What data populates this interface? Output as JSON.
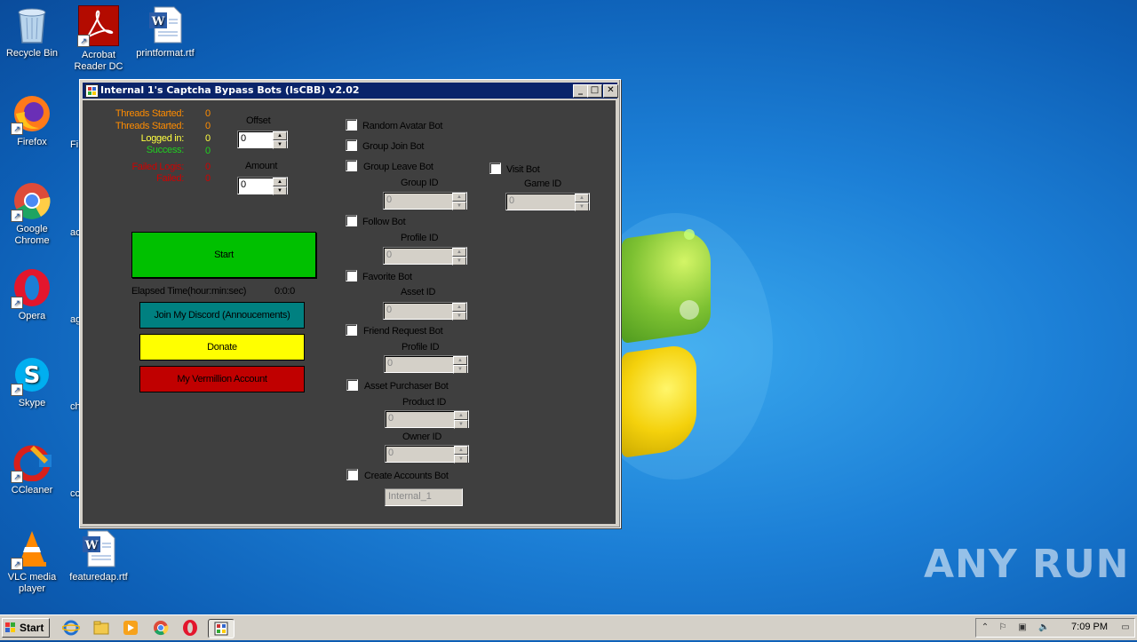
{
  "desktop": {
    "icons": [
      {
        "label": "Recycle Bin"
      },
      {
        "label": "Acrobat Reader DC"
      },
      {
        "label": "printformat.rtf"
      },
      {
        "label": "Firefox"
      },
      {
        "label": "Google Chrome"
      },
      {
        "label": "Opera"
      },
      {
        "label": "Skype"
      },
      {
        "label": "CCleaner"
      },
      {
        "label": "VLC media player"
      },
      {
        "label": "featuredap.rtf"
      }
    ],
    "clipped_labels": [
      "Fi",
      "ac",
      "ag",
      "ch",
      "cc"
    ],
    "watermark": "ANY RUN"
  },
  "window": {
    "title": "Internal 1's Captcha Bypass Bots (IsCBB) v2.02",
    "stats": [
      {
        "label": "Threads Started:",
        "value": "0",
        "color": "#ff8c00"
      },
      {
        "label": "Threads Started:",
        "value": "0",
        "color": "#ff8c00"
      },
      {
        "label": "Logged in:",
        "value": "0",
        "color": "#ffff40"
      },
      {
        "label": "Success:",
        "value": "0",
        "color": "#20d020"
      },
      {
        "label": "Failed Logis:",
        "value": "0",
        "color": "#d00000"
      },
      {
        "label": "Failed:",
        "value": "0",
        "color": "#d00000"
      }
    ],
    "offset_label": "Offset",
    "offset_value": "0",
    "amount_label": "Amount",
    "amount_value": "0",
    "start_button": "Start",
    "elapsed_label": "Elapsed Time(hour:min:sec)",
    "elapsed_value": "0:0:0",
    "discord_button": "Join My Discord (Annoucements)",
    "donate_button": "Donate",
    "vermillion_button": "My Vermillion Account",
    "bots": {
      "random_avatar": "Random Avatar Bot",
      "group_join": "Group Join Bot",
      "group_leave": "Group Leave Bot",
      "group_id_label": "Group ID",
      "group_id_value": "0",
      "visit": "Visit Bot",
      "game_id_label": "Game ID",
      "game_id_value": "0",
      "follow": "Follow Bot",
      "follow_profile_label": "Profile ID",
      "follow_profile_value": "0",
      "favorite": "Favorite Bot",
      "asset_id_label": "Asset ID",
      "asset_id_value": "0",
      "friend_request": "Friend Request Bot",
      "friend_profile_label": "Profile ID",
      "friend_profile_value": "0",
      "asset_purchaser": "Asset Purchaser Bot",
      "product_id_label": "Product ID",
      "product_id_value": "0",
      "owner_id_label": "Owner ID",
      "owner_id_value": "0",
      "create_accounts": "Create Accounts Bot",
      "create_accounts_value": "Internal_1"
    },
    "colors": {
      "start": "#00c000",
      "discord": "#008080",
      "donate": "#ffff00",
      "vermillion": "#c00000"
    }
  },
  "taskbar": {
    "start_label": "Start",
    "clock": "7:09 PM"
  }
}
